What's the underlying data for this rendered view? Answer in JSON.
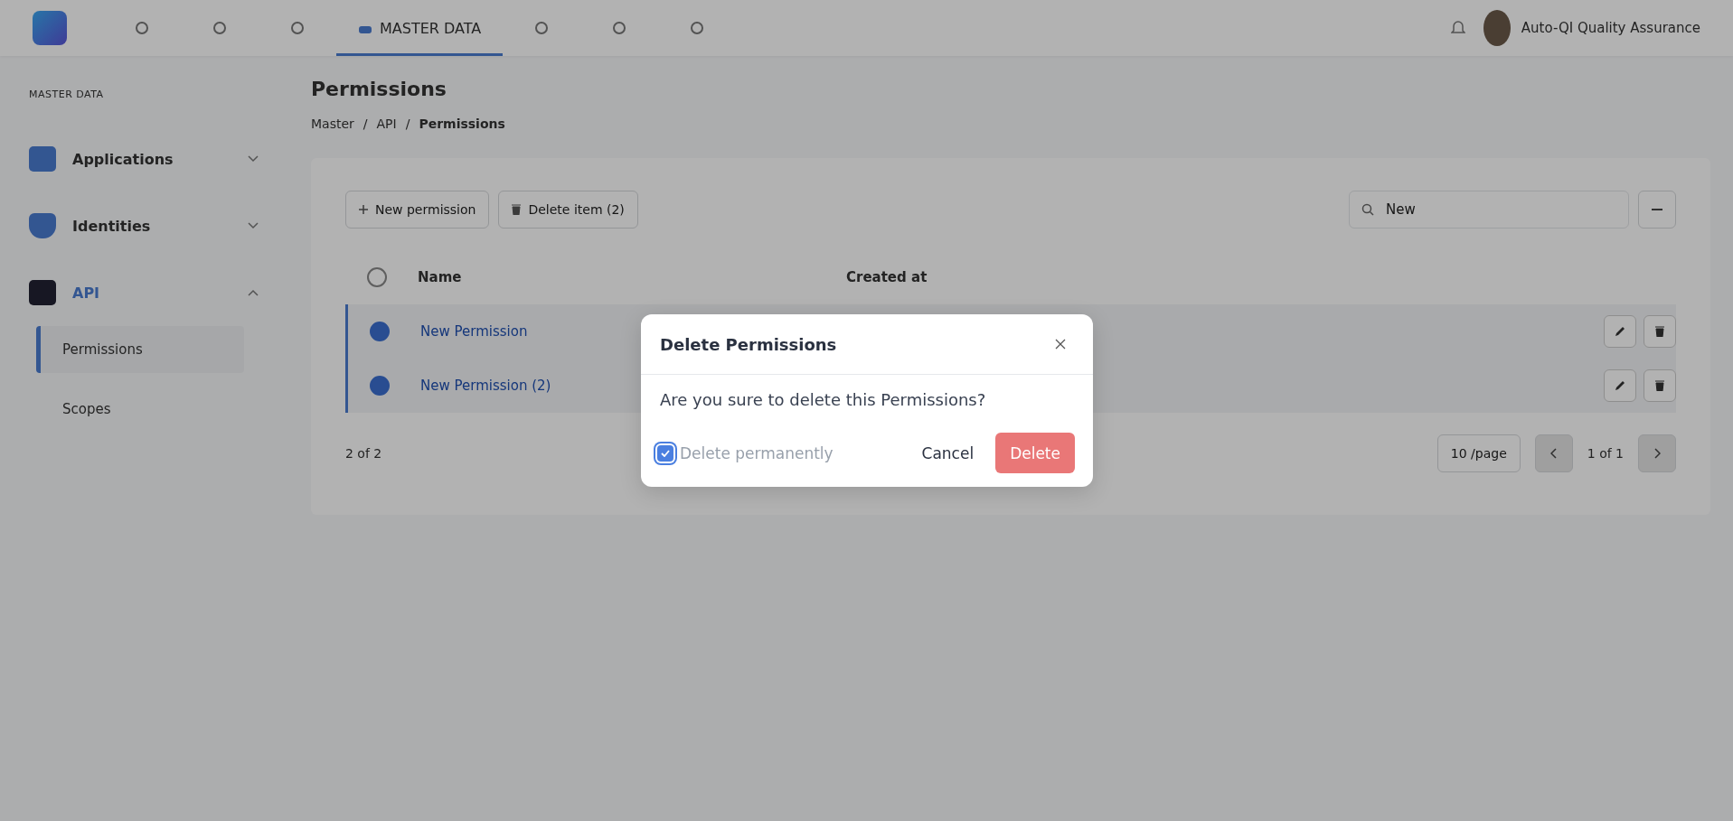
{
  "top_nav": {
    "items": [
      {
        "kind": "icon",
        "selected": false
      },
      {
        "kind": "icon",
        "selected": false
      },
      {
        "kind": "icon",
        "selected": false
      },
      {
        "kind": "tab",
        "label": "MASTER DATA",
        "selected": true
      },
      {
        "kind": "icon",
        "selected": false
      },
      {
        "kind": "icon",
        "selected": false
      },
      {
        "kind": "icon",
        "selected": false
      }
    ],
    "user": "Auto-QI Quality Assurance"
  },
  "sidebar": {
    "heading": "MASTER DATA",
    "groups": [
      {
        "label": "Applications",
        "expanded": false
      },
      {
        "label": "Identities",
        "expanded": false
      },
      {
        "label": "API",
        "expanded": true,
        "children": [
          {
            "label": "Permissions",
            "selected": true
          },
          {
            "label": "Scopes",
            "selected": false
          }
        ]
      }
    ]
  },
  "page": {
    "title": "Permissions",
    "breadcrumb": [
      "Master",
      "API",
      "Permissions"
    ],
    "breadcrumb_separator": "/"
  },
  "toolbar": {
    "new_button": "New permission",
    "delete_button": "Delete item (2)",
    "search_value": "New"
  },
  "table": {
    "select_all_checked": false,
    "columns": [
      "Name",
      "Created at"
    ],
    "rows": [
      {
        "name": "New Permission",
        "checked": true
      },
      {
        "name": "New Permission (2)",
        "checked": true
      }
    ]
  },
  "footer": {
    "count": "2 of 2",
    "page_size": "10 /page",
    "pages": "1 of 1"
  },
  "dialog": {
    "title": "Delete Permissions",
    "message": "Are you sure to delete this Permissions?",
    "option": {
      "label": "Delete permanently",
      "checked": true
    },
    "cancel": "Cancel",
    "confirm": "Delete"
  }
}
